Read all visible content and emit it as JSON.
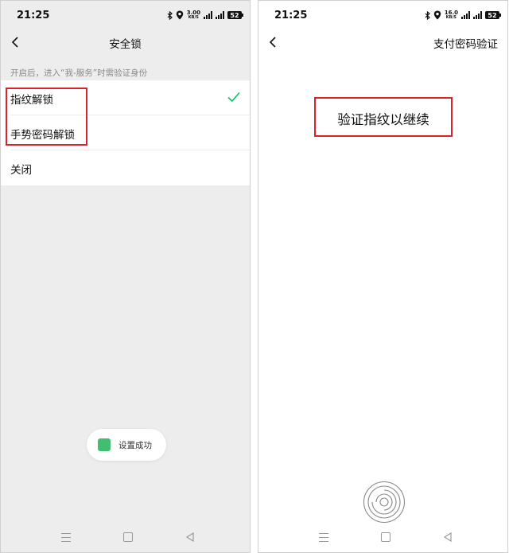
{
  "left_screen": {
    "status": {
      "time": "21:25",
      "network_speed_value": "3.00",
      "network_speed_unit": "KB/S",
      "battery": "52"
    },
    "header": {
      "title": "安全锁"
    },
    "hint": "开启后，进入“我-服务”时需验证身份",
    "options": [
      {
        "label": "指纹解锁",
        "selected": true
      },
      {
        "label": "手势密码解锁",
        "selected": false
      },
      {
        "label": "关闭",
        "selected": false
      }
    ],
    "toast": {
      "text": "设置成功"
    }
  },
  "right_screen": {
    "status": {
      "time": "21:25",
      "network_speed_value": "16.0",
      "network_speed_unit": "KB/S",
      "battery": "52"
    },
    "header": {
      "title": "支付密码验证"
    },
    "prompt": "验证指纹以继续"
  },
  "colors": {
    "accent_green": "#07c160",
    "highlight_red": "#d8232a",
    "page_gray": "#ededed"
  }
}
